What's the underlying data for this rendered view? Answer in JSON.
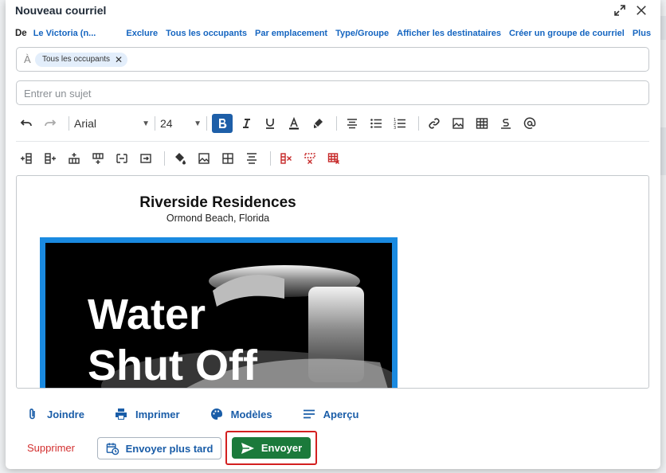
{
  "window": {
    "title": "Nouveau courriel"
  },
  "from": {
    "label": "De",
    "value": "Le Victoria (n...",
    "links": [
      "Exclure",
      "Tous les occupants",
      "Par emplacement",
      "Type/Groupe",
      "Afficher les destinataires",
      "Créer un groupe de courriel",
      "Plus"
    ]
  },
  "to": {
    "label": "À",
    "chip": "Tous les occupants"
  },
  "subject": {
    "placeholder": "Entrer un sujet",
    "value": ""
  },
  "toolbar": {
    "font": "Arial",
    "size": "24"
  },
  "editor": {
    "heading": "Riverside Residences",
    "subheading": "Ormond Beach, Florida",
    "poster_line1": "Water",
    "poster_line2": "Shut Off"
  },
  "footer": {
    "attach": "Joindre",
    "print": "Imprimer",
    "templates": "Modèles",
    "preview": "Aperçu",
    "delete": "Supprimer",
    "send_later": "Envoyer plus tard",
    "send": "Envoyer"
  },
  "colors": {
    "accent": "#1565c0",
    "send": "#1b7a3b",
    "danger": "#d32f2f",
    "poster_border": "#1a8ae0"
  }
}
